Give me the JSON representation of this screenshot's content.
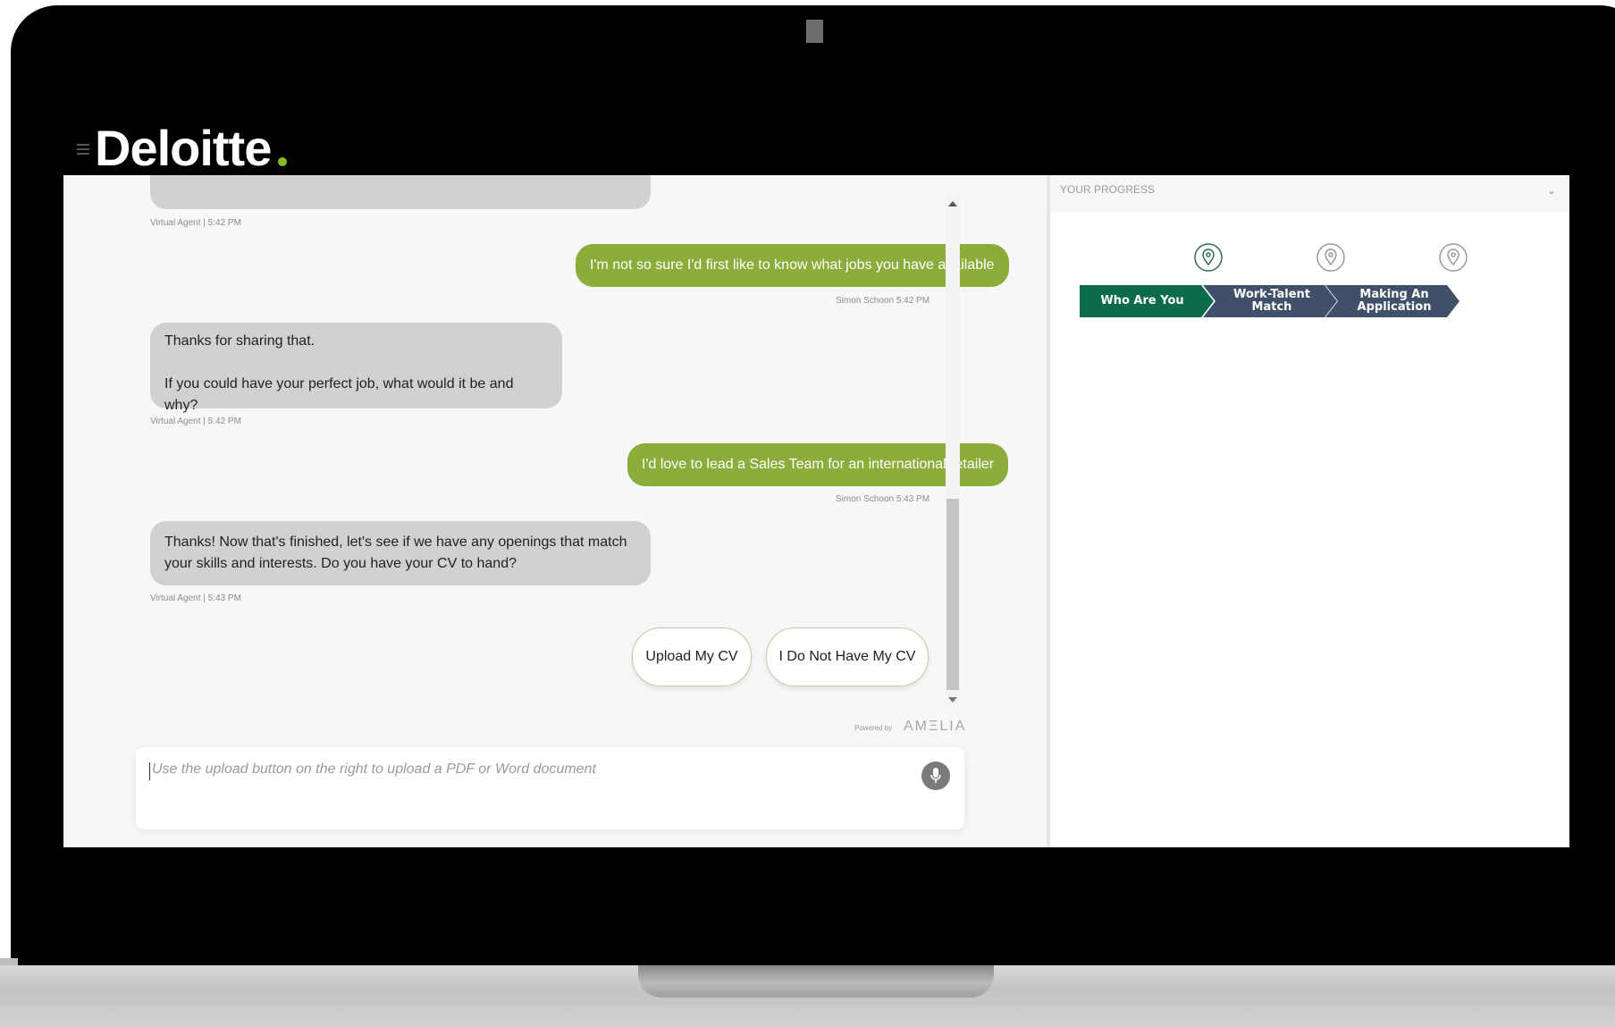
{
  "header": {
    "logo_text": "Deloitte",
    "logo_dot_color": "#86bc25"
  },
  "chat": {
    "messages": [
      {
        "role": "agent",
        "lines": [],
        "meta": "Virtual Agent | 5:42 PM"
      },
      {
        "role": "user",
        "text": "I'm not so sure I'd first like to know what jobs you have available",
        "meta": "Simon Schoon 5:42 PM"
      },
      {
        "role": "agent",
        "lines": [
          "Thanks for sharing that.",
          "If you could have your perfect job, what would it be and why?"
        ],
        "meta": "Virtual Agent | 5:42 PM"
      },
      {
        "role": "user",
        "text": "I'd love to lead a Sales Team for an international retailer",
        "meta": "Simon Schoon 5:43 PM"
      },
      {
        "role": "agent",
        "lines": [
          "Thanks! Now that's finished, let's see if we have any openings that match",
          "your skills and interests. Do you have your CV to hand?"
        ],
        "meta": "Virtual Agent | 5:43 PM"
      }
    ],
    "options": [
      "Upload My CV",
      "I Do Not Have My CV"
    ],
    "powered_by": "Powered by",
    "brand": "AMΞLIA",
    "input_placeholder": "Use the upload button on the right to upload a PDF or Word document",
    "icons": {
      "mic": "microphone-icon"
    },
    "colors": {
      "user_bubble": "#8cac3c",
      "agent_bubble": "#d1d1d3"
    }
  },
  "progress": {
    "title": "YOUR PROGRESS",
    "steps": [
      {
        "label_lines": [
          "Who Are You"
        ],
        "status": "active",
        "color": "#0c6b4a"
      },
      {
        "label_lines": [
          "Work-Talent",
          "Match"
        ],
        "status": "pending",
        "color": "#3f5068"
      },
      {
        "label_lines": [
          "Making An",
          "Application"
        ],
        "status": "pending",
        "color": "#3f5068"
      }
    ]
  }
}
